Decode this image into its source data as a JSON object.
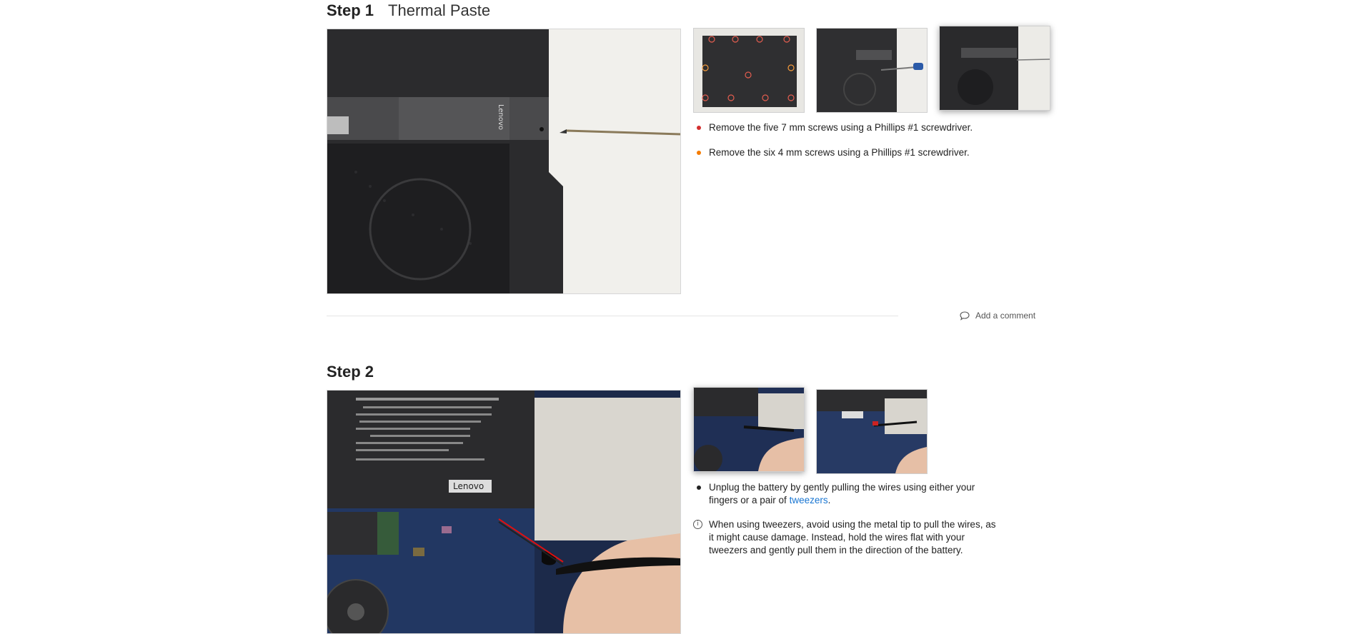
{
  "step1": {
    "number": "Step 1",
    "title": "Thermal Paste",
    "bullets": [
      {
        "color": "#d32f2f",
        "text": "Remove the five 7 mm screws using a Phillips #1 screwdriver."
      },
      {
        "color": "#f57c00",
        "text": "Remove the six 4 mm screws using a Phillips #1 screwdriver."
      }
    ],
    "photo_label_brand": "Lenovo"
  },
  "comment": {
    "label": "Add a comment",
    "icon": "comment-icon"
  },
  "step2": {
    "number": "Step 2",
    "bullet_text": "Unplug the battery by gently pulling the wires using either your fingers or a pair of ",
    "bullet_link": "tweezers",
    "bullet_end": ".",
    "note_text": "When using tweezers, avoid using the metal tip to pull the wires, as it might cause damage. Instead, hold the wires flat with your tweezers and gently pull them in the direction of the battery.",
    "note_icon": "info-icon",
    "photo_label_brand": "Lenovo"
  }
}
